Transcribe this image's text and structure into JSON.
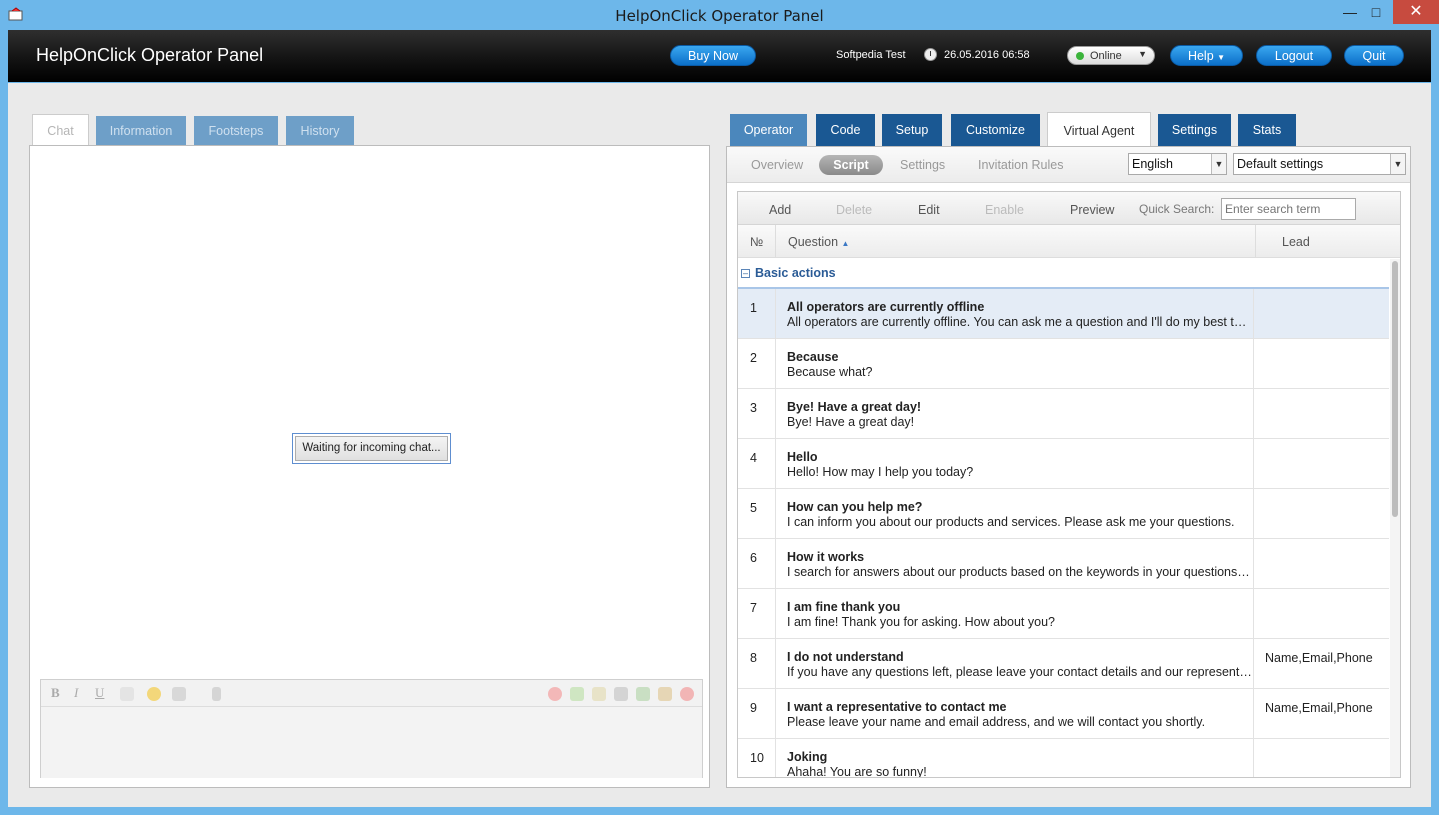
{
  "window": {
    "title": "HelpOnClick Operator Panel",
    "min": "—",
    "max": "□",
    "close": "✕"
  },
  "header": {
    "title": "HelpOnClick Operator Panel",
    "buy_now": "Buy Now",
    "user": "Softpedia Test",
    "datetime": "26.05.2016 06:58",
    "status": "Online",
    "help": "Help",
    "logout": "Logout",
    "quit": "Quit"
  },
  "left_tabs": [
    "Chat",
    "Information",
    "Footsteps",
    "History"
  ],
  "chat": {
    "waiting": "Waiting for incoming chat..."
  },
  "editor": {
    "bold": "B",
    "italic": "I",
    "underline": "U"
  },
  "right_tabs": [
    "Operator",
    "Code",
    "Setup",
    "Customize",
    "Virtual Agent",
    "Settings",
    "Stats"
  ],
  "subnav": {
    "items": [
      "Overview",
      "Script",
      "Settings",
      "Invitation Rules"
    ],
    "language": "English",
    "profile": "Default settings"
  },
  "grid": {
    "actions": [
      "Add",
      "Delete",
      "Edit",
      "Enable",
      "Preview"
    ],
    "quick_search_label": "Quick Search:",
    "search_placeholder": "Enter search term",
    "columns": {
      "num": "№",
      "question": "Question",
      "lead": "Lead"
    },
    "group": "Basic actions",
    "rows": [
      {
        "num": "1",
        "q": "All operators are currently offline",
        "a": "All operators are currently offline. You can ask me a question and I'll do my best to answer it.",
        "lead": ""
      },
      {
        "num": "2",
        "q": "Because",
        "a": "Because what?",
        "lead": ""
      },
      {
        "num": "3",
        "q": "Bye! Have a great day!",
        "a": "Bye! Have a great day!",
        "lead": ""
      },
      {
        "num": "4",
        "q": "Hello",
        "a": "Hello! How may I help you today?",
        "lead": ""
      },
      {
        "num": "5",
        "q": "How can you help me?",
        "a": "I can inform you about our products and services. Please ask me your questions.",
        "lead": ""
      },
      {
        "num": "6",
        "q": "How it works",
        "a": "I search for answers about our products based on the keywords in your questions. Please ask",
        "lead": ""
      },
      {
        "num": "7",
        "q": "I am fine thank you",
        "a": "I am fine! Thank you for asking. How about you?",
        "lead": ""
      },
      {
        "num": "8",
        "q": "I do not understand",
        "a": "If you have any questions left, please leave your contact details and our representative will contact you",
        "lead": "Name,Email,Phone"
      },
      {
        "num": "9",
        "q": "I want a representative to contact me",
        "a": "Please leave your name and email address, and we will contact you shortly.",
        "lead": "Name,Email,Phone"
      },
      {
        "num": "10",
        "q": "Joking",
        "a": "Ahaha! You are so funny!",
        "lead": ""
      }
    ]
  }
}
